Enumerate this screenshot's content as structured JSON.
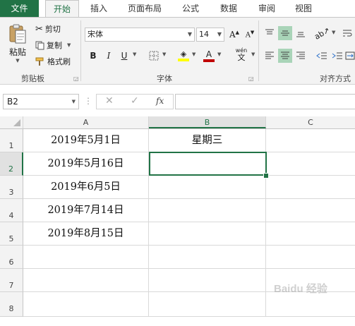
{
  "tabs": [
    "文件",
    "开始",
    "插入",
    "页面布局",
    "公式",
    "数据",
    "审阅",
    "视图"
  ],
  "active_tab": "开始",
  "clipboard": {
    "paste_label": "粘贴",
    "cut_label": "剪切",
    "copy_label": "复制",
    "format_painter_label": "格式刷",
    "group_label": "剪贴板"
  },
  "font": {
    "font_name": "宋体",
    "font_size": "14",
    "bold": "B",
    "italic": "I",
    "underline": "U",
    "font_color_glyph": "A",
    "phonetic": "wén",
    "group_label": "字体"
  },
  "alignment": {
    "group_label": "对齐方式"
  },
  "formula_bar": {
    "name_box": "B2",
    "fx": "fx",
    "value": ""
  },
  "columns": [
    "A",
    "B",
    "C"
  ],
  "rows": [
    "1",
    "2",
    "3",
    "4",
    "5",
    "6",
    "7",
    "8"
  ],
  "cells": {
    "A1": "2019年5月1日",
    "A2": "2019年5月16日",
    "A3": "2019年6月5日",
    "A4": "2019年7月14日",
    "A5": "2019年8月15日",
    "B1": "星期三"
  },
  "selected_cell": "B2",
  "watermark": "Baidu 经验",
  "colors": {
    "accent": "#217346",
    "selected_align": "#a9d4b8",
    "font_color_underline": "#c00000",
    "fill_color_underline": "#ffff00"
  }
}
